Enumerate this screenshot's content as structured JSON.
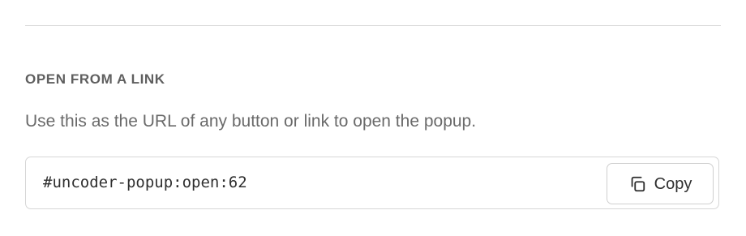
{
  "section": {
    "title": "OPEN FROM A LINK",
    "description": "Use this as the URL of any button or link to open the popup."
  },
  "url_field": {
    "value": "#uncoder-popup:open:62"
  },
  "copy_button": {
    "label": "Copy",
    "icon": "copy-icon"
  }
}
